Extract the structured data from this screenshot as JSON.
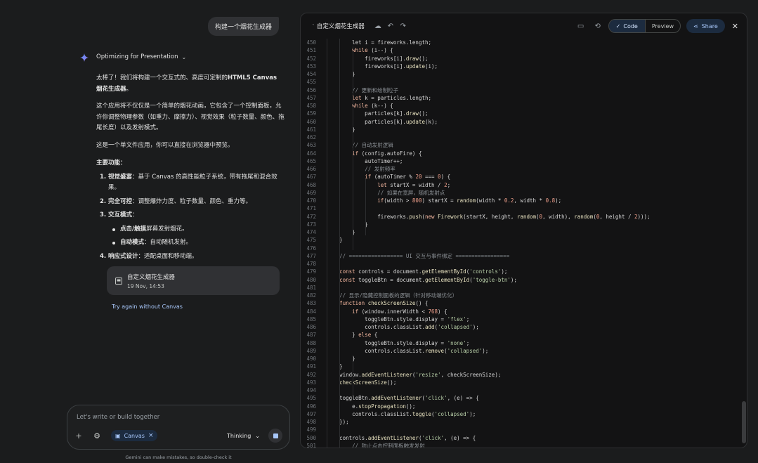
{
  "chat": {
    "user_prompt": "构建一个烟花生成器",
    "thinking_label": "Optimizing for Presentation",
    "intro_prefix": "太棒了！我们将构建一个交互式的、高度可定制的",
    "intro_bold": "HTML5 Canvas 烟花生成器",
    "intro_suffix": "。",
    "para2": "这个应用将不仅仅是一个简单的烟花动画，它包含了一个控制面板，允许你调整物理参数（如重力、摩擦力）、视觉效果（粒子数量、颜色、拖尾长度）以及发射模式。",
    "para3": "这是一个单文件应用，你可以直接在浏览器中预览。",
    "features_heading": "主要功能：",
    "features": [
      {
        "num": "1.",
        "title": "视觉盛宴",
        "text": "：基于 Canvas 的高性能粒子系统，带有拖尾和混合效果。"
      },
      {
        "num": "2.",
        "title": "完全可控",
        "text": "：调整爆炸力度、粒子数量、颜色、重力等。"
      },
      {
        "num": "3.",
        "title": "交互模式",
        "text": "："
      },
      {
        "num": "4.",
        "title": "响应式设计",
        "text": "：适配桌面和移动端。"
      }
    ],
    "sub_features": [
      {
        "title": "点击/触摸",
        "text": "屏幕发射烟花。"
      },
      {
        "title": "自动模式",
        "text": "：自动随机发射。"
      }
    ],
    "canvas_card": {
      "title": "自定义烟花生成器",
      "date": "19 Nov, 14:53"
    },
    "try_again": "Try again without Canvas",
    "input_placeholder": "Let's write or build together",
    "canvas_chip": "Canvas",
    "model_label": "Thinking",
    "disclaimer": "Gemini can make mistakes, so double-check it"
  },
  "canvas": {
    "title": "自定义烟花生成器",
    "code_tab": "Code",
    "preview_tab": "Preview",
    "share_label": "Share"
  },
  "code_lines": [
    {
      "n": "450",
      "html": "        let i = fireworks.length;"
    },
    {
      "n": "451",
      "html": "        <span class='k'>while</span> (i--) {"
    },
    {
      "n": "452",
      "html": "            fireworks[i].<span class='f'>draw</span>();"
    },
    {
      "n": "453",
      "html": "            fireworks[i].<span class='f'>update</span>(i);"
    },
    {
      "n": "454",
      "html": "        }"
    },
    {
      "n": "455",
      "html": ""
    },
    {
      "n": "456",
      "html": "        <span class='c'>// 更新和绘制粒子</span>"
    },
    {
      "n": "457",
      "html": "        <span class='k'>let</span> k = particles.length;"
    },
    {
      "n": "458",
      "html": "        <span class='k'>while</span> (k--) {"
    },
    {
      "n": "459",
      "html": "            particles[k].<span class='f'>draw</span>();"
    },
    {
      "n": "460",
      "html": "            particles[k].<span class='f'>update</span>(k);"
    },
    {
      "n": "461",
      "html": "        }"
    },
    {
      "n": "462",
      "html": ""
    },
    {
      "n": "463",
      "html": "        <span class='c'>// 自动发射逻辑</span>"
    },
    {
      "n": "464",
      "html": "        <span class='k'>if</span> (config.autoFire) {"
    },
    {
      "n": "465",
      "html": "            autoTimer++;"
    },
    {
      "n": "466",
      "html": "            <span class='c'>// 发射频率</span>"
    },
    {
      "n": "467",
      "html": "            <span class='k'>if</span> (autoTimer % <span class='n'>20</span> === <span class='n'>0</span>) {"
    },
    {
      "n": "468",
      "html": "                <span class='k'>let</span> startX = width / <span class='n'>2</span>;"
    },
    {
      "n": "469",
      "html": "                <span class='c'>// 如果在宽屏，随机发射点</span>"
    },
    {
      "n": "470",
      "html": "                <span class='k'>if</span>(width > <span class='n'>800</span>) startX = <span class='f'>random</span>(width * <span class='n'>0.2</span>, width * <span class='n'>0.8</span>);"
    },
    {
      "n": "471",
      "html": ""
    },
    {
      "n": "472",
      "html": "                fireworks.<span class='f'>push</span>(<span class='k'>new</span> <span class='f'>Firework</span>(startX, height, <span class='f'>random</span>(<span class='n'>0</span>, width), <span class='f'>random</span>(<span class='n'>0</span>, height / <span class='n'>2</span>)));"
    },
    {
      "n": "473",
      "html": "            }"
    },
    {
      "n": "474",
      "html": "        }"
    },
    {
      "n": "475",
      "html": "    }"
    },
    {
      "n": "476",
      "html": ""
    },
    {
      "n": "477",
      "html": "    <span class='c'>// ================= UI 交互与事件绑定 =================</span>"
    },
    {
      "n": "478",
      "html": ""
    },
    {
      "n": "479",
      "html": "    <span class='k'>const</span> controls = document.<span class='f'>getElementById</span>(<span class='s'>'controls'</span>);"
    },
    {
      "n": "480",
      "html": "    <span class='k'>const</span> toggleBtn = document.<span class='f'>getElementById</span>(<span class='s'>'toggle-btn'</span>);"
    },
    {
      "n": "481",
      "html": ""
    },
    {
      "n": "482",
      "html": "    <span class='c'>// 显示/隐藏控制面板的逻辑（针对移动端优化）</span>"
    },
    {
      "n": "483",
      "html": "    <span class='k'>function</span> <span class='f'>checkScreenSize</span>() {"
    },
    {
      "n": "484",
      "html": "        <span class='k'>if</span> (window.innerWidth < <span class='n'>768</span>) {"
    },
    {
      "n": "485",
      "html": "            toggleBtn.style.display = <span class='s'>'flex'</span>;"
    },
    {
      "n": "486",
      "html": "            controls.classList.<span class='f'>add</span>(<span class='s'>'collapsed'</span>);"
    },
    {
      "n": "487",
      "html": "        } <span class='k'>else</span> {"
    },
    {
      "n": "488",
      "html": "            toggleBtn.style.display = <span class='s'>'none'</span>;"
    },
    {
      "n": "489",
      "html": "            controls.classList.<span class='f'>remove</span>(<span class='s'>'collapsed'</span>);"
    },
    {
      "n": "490",
      "html": "        }"
    },
    {
      "n": "491",
      "html": "    }"
    },
    {
      "n": "492",
      "html": "    window.<span class='f'>addEventListener</span>(<span class='s'>'resize'</span>, checkScreenSize);"
    },
    {
      "n": "493",
      "html": "    <span class='f'>checkScreenSize</span>();"
    },
    {
      "n": "494",
      "html": ""
    },
    {
      "n": "495",
      "html": "    toggleBtn.<span class='f'>addEventListener</span>(<span class='s'>'click'</span>, (e) => {"
    },
    {
      "n": "496",
      "html": "        e.<span class='f'>stopPropagation</span>();"
    },
    {
      "n": "497",
      "html": "        controls.classList.<span class='f'>toggle</span>(<span class='s'>'collapsed'</span>);"
    },
    {
      "n": "498",
      "html": "    });"
    },
    {
      "n": "499",
      "html": ""
    },
    {
      "n": "500",
      "html": "    controls.<span class='f'>addEventListener</span>(<span class='s'>'click'</span>, (e) => {"
    },
    {
      "n": "501",
      "html": "        <span class='c'>// 防止点击控制面板触发发射</span>"
    }
  ]
}
